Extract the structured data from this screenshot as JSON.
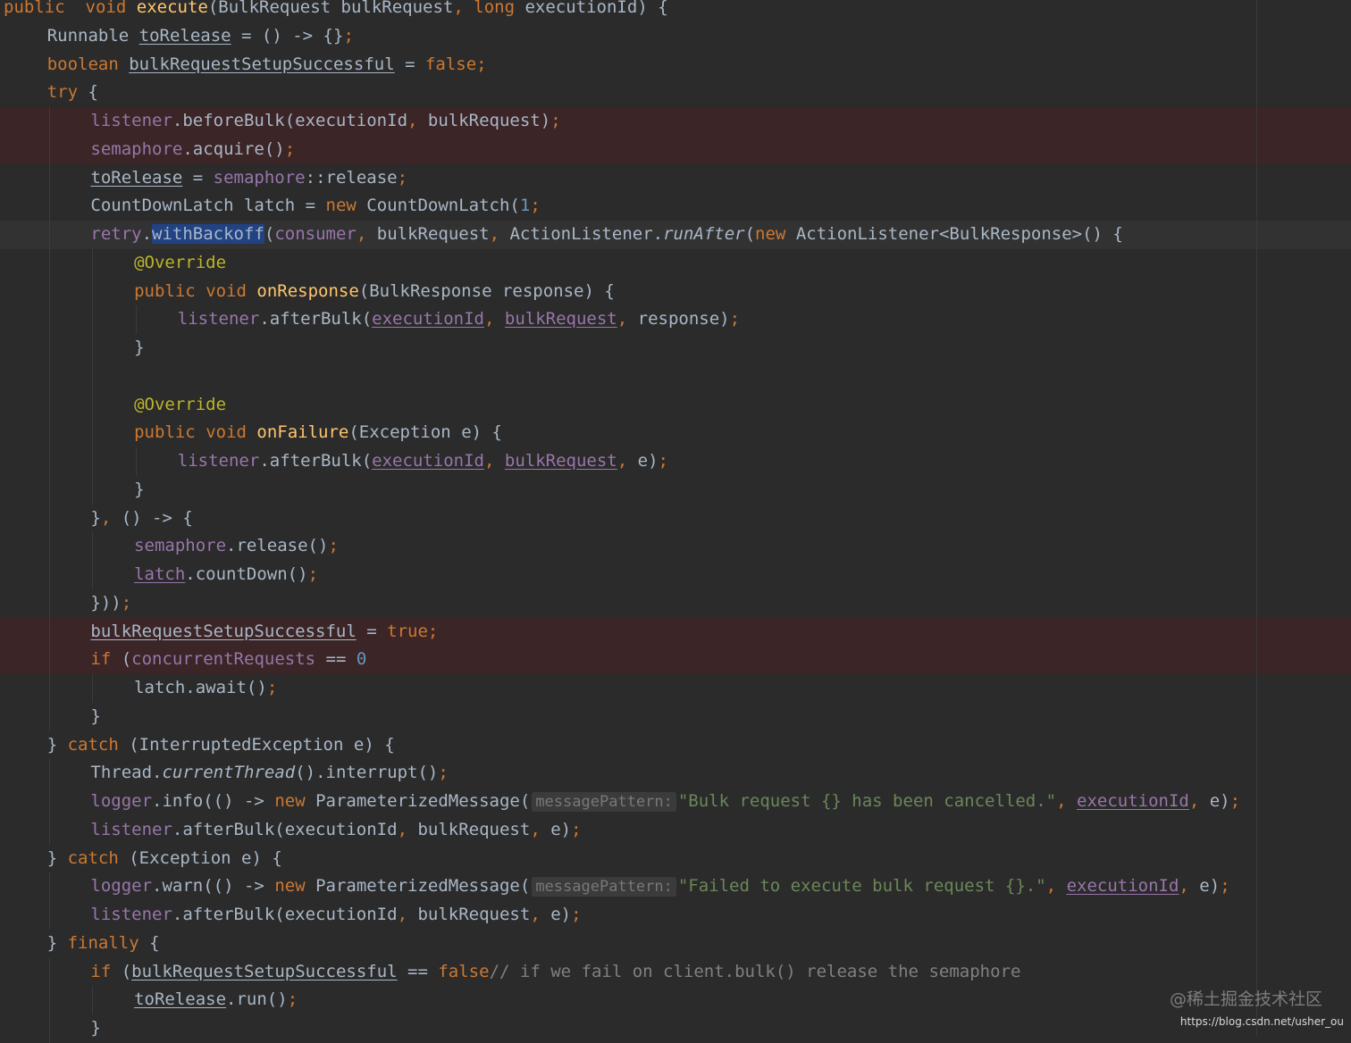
{
  "lines": [
    {
      "indent": 0,
      "tokens": [
        [
          "kw",
          "public"
        ],
        [
          "",
          "  "
        ],
        [
          "kw",
          "void"
        ],
        [
          "",
          " "
        ],
        [
          "fn",
          "execute"
        ],
        [
          "",
          "(BulkRequest bulkRequest"
        ],
        [
          "kw",
          ","
        ],
        [
          "",
          " "
        ],
        [
          "kw",
          "long"
        ],
        [
          "",
          " executionId) {"
        ]
      ]
    },
    {
      "indent": 1,
      "tokens": [
        [
          "",
          "Runnable "
        ],
        [
          "ul",
          "toRelease"
        ],
        [
          "",
          " = () -> {}"
        ],
        [
          "kw",
          ";"
        ]
      ]
    },
    {
      "indent": 1,
      "tokens": [
        [
          "kw",
          "boolean"
        ],
        [
          "",
          " "
        ],
        [
          "ul",
          "bulkRequestSetupSuccessful"
        ],
        [
          "",
          " = "
        ],
        [
          "kw",
          "false;"
        ]
      ]
    },
    {
      "indent": 1,
      "tokens": [
        [
          "kw",
          "try"
        ],
        [
          "",
          " {"
        ]
      ]
    },
    {
      "indent": 2,
      "bg": "err",
      "tokens": [
        [
          "field",
          "listener"
        ],
        [
          "",
          ".beforeBulk(executionId"
        ],
        [
          "kw",
          ","
        ],
        [
          "",
          " bulkRequest)"
        ],
        [
          "kw",
          ";"
        ]
      ]
    },
    {
      "indent": 2,
      "bg": "err",
      "tokens": [
        [
          "field",
          "semaphore"
        ],
        [
          "",
          ".acquire()"
        ],
        [
          "kw",
          ";"
        ]
      ]
    },
    {
      "indent": 2,
      "tokens": [
        [
          "ul",
          "toRelease"
        ],
        [
          "",
          " = "
        ],
        [
          "field",
          "semaphore"
        ],
        [
          "",
          "::release"
        ],
        [
          "kw",
          ";"
        ]
      ]
    },
    {
      "indent": 2,
      "tokens": [
        [
          "",
          "CountDownLatch latch = "
        ],
        [
          "kw",
          "new"
        ],
        [
          "",
          " CountDownLatch("
        ],
        [
          "num",
          "1"
        ],
        [
          ")"
        ],
        [
          "kw",
          ";"
        ]
      ]
    },
    {
      "indent": 2,
      "bg": "caret",
      "tokens": [
        [
          "field",
          "retry"
        ],
        [
          "",
          "."
        ],
        [
          "sel",
          "withBackoff"
        ],
        [
          "",
          "("
        ],
        [
          "field",
          "consumer"
        ],
        [
          "kw",
          ","
        ],
        [
          "",
          " bulkRequest"
        ],
        [
          "kw",
          ","
        ],
        [
          "",
          " ActionListener."
        ],
        [
          "it",
          "runAfter"
        ],
        [
          "",
          "("
        ],
        [
          "kw",
          "new"
        ],
        [
          "",
          " ActionListener<BulkResponse>() {"
        ]
      ]
    },
    {
      "indent": 3,
      "tokens": [
        [
          "ann",
          "@Override"
        ]
      ]
    },
    {
      "indent": 3,
      "tokens": [
        [
          "kw",
          "public"
        ],
        [
          "",
          " "
        ],
        [
          "kw",
          "void"
        ],
        [
          "",
          " "
        ],
        [
          "fn",
          "onResponse"
        ],
        [
          "",
          "(BulkResponse response) {"
        ]
      ]
    },
    {
      "indent": 4,
      "tokens": [
        [
          "field",
          "listener"
        ],
        [
          "",
          ".afterBulk("
        ],
        [
          "field ul",
          "executionId"
        ],
        [
          "kw",
          ","
        ],
        [
          "",
          " "
        ],
        [
          "field ul",
          "bulkRequest"
        ],
        [
          "kw",
          ","
        ],
        [
          "",
          " response)"
        ],
        [
          "kw",
          ";"
        ]
      ]
    },
    {
      "indent": 3,
      "tokens": [
        [
          "",
          "}"
        ]
      ]
    },
    {
      "indent": 3,
      "tokens": []
    },
    {
      "indent": 3,
      "tokens": [
        [
          "ann",
          "@Override"
        ]
      ]
    },
    {
      "indent": 3,
      "tokens": [
        [
          "kw",
          "public"
        ],
        [
          "",
          " "
        ],
        [
          "kw",
          "void"
        ],
        [
          "",
          " "
        ],
        [
          "fn",
          "onFailure"
        ],
        [
          "",
          "(Exception e) {"
        ]
      ]
    },
    {
      "indent": 4,
      "tokens": [
        [
          "field",
          "listener"
        ],
        [
          "",
          ".afterBulk("
        ],
        [
          "field ul",
          "executionId"
        ],
        [
          "kw",
          ","
        ],
        [
          "",
          " "
        ],
        [
          "field ul",
          "bulkRequest"
        ],
        [
          "kw",
          ","
        ],
        [
          "",
          " e)"
        ],
        [
          "kw",
          ";"
        ]
      ]
    },
    {
      "indent": 3,
      "tokens": [
        [
          "",
          "}"
        ]
      ]
    },
    {
      "indent": 2,
      "tokens": [
        [
          "",
          "}"
        ],
        [
          "kw",
          ","
        ],
        [
          "",
          " () -> {"
        ]
      ]
    },
    {
      "indent": 3,
      "tokens": [
        [
          "field",
          "semaphore"
        ],
        [
          "",
          ".release()"
        ],
        [
          "kw",
          ";"
        ]
      ]
    },
    {
      "indent": 3,
      "tokens": [
        [
          "field ul",
          "latch"
        ],
        [
          "",
          ".countDown()"
        ],
        [
          "kw",
          ";"
        ]
      ]
    },
    {
      "indent": 2,
      "tokens": [
        [
          "",
          "}))"
        ],
        [
          "kw",
          ";"
        ]
      ]
    },
    {
      "indent": 2,
      "bg": "err",
      "tokens": [
        [
          "ul",
          "bulkRequestSetupSuccessful"
        ],
        [
          "",
          " = "
        ],
        [
          "kw",
          "true;"
        ]
      ]
    },
    {
      "indent": 2,
      "bg": "err",
      "tokens": [
        [
          "kw",
          "if"
        ],
        [
          "",
          " ("
        ],
        [
          "field",
          "concurrentRequests"
        ],
        [
          "",
          " == "
        ],
        [
          "num",
          "0"
        ],
        [
          ") {"
        ]
      ]
    },
    {
      "indent": 3,
      "tokens": [
        [
          "",
          "latch.await()"
        ],
        [
          "kw",
          ";"
        ]
      ]
    },
    {
      "indent": 2,
      "tokens": [
        [
          "",
          "}"
        ]
      ]
    },
    {
      "indent": 1,
      "tokens": [
        [
          "",
          "} "
        ],
        [
          "kw",
          "catch"
        ],
        [
          "",
          " (InterruptedException e) {"
        ]
      ]
    },
    {
      "indent": 2,
      "tokens": [
        [
          "",
          "Thread."
        ],
        [
          "it",
          "currentThread"
        ],
        [
          "",
          "().interrupt()"
        ],
        [
          "kw",
          ";"
        ]
      ]
    },
    {
      "indent": 2,
      "tokens": [
        [
          "field",
          "logger"
        ],
        [
          "",
          ".info(() -> "
        ],
        [
          "kw",
          "new"
        ],
        [
          "",
          " ParameterizedMessage("
        ],
        [
          "hint",
          "messagePattern:"
        ],
        [
          "str",
          "\"Bulk request {} has been cancelled.\""
        ],
        [
          "kw",
          ","
        ],
        [
          "",
          " "
        ],
        [
          "field ul",
          "executionId"
        ],
        [
          ")"
        ],
        [
          "kw",
          ","
        ],
        [
          "",
          " e)"
        ],
        [
          "kw",
          ";"
        ]
      ]
    },
    {
      "indent": 2,
      "tokens": [
        [
          "field",
          "listener"
        ],
        [
          "",
          ".afterBulk(executionId"
        ],
        [
          "kw",
          ","
        ],
        [
          "",
          " bulkRequest"
        ],
        [
          "kw",
          ","
        ],
        [
          "",
          " e)"
        ],
        [
          "kw",
          ";"
        ]
      ]
    },
    {
      "indent": 1,
      "tokens": [
        [
          "",
          "} "
        ],
        [
          "kw",
          "catch"
        ],
        [
          "",
          " (Exception e) {"
        ]
      ]
    },
    {
      "indent": 2,
      "tokens": [
        [
          "field",
          "logger"
        ],
        [
          "",
          ".warn(() -> "
        ],
        [
          "kw",
          "new"
        ],
        [
          "",
          " ParameterizedMessage("
        ],
        [
          "hint",
          "messagePattern:"
        ],
        [
          "str",
          "\"Failed to execute bulk request {}.\""
        ],
        [
          "kw",
          ","
        ],
        [
          "",
          " "
        ],
        [
          "field ul",
          "executionId"
        ],
        [
          ")"
        ],
        [
          "kw",
          ","
        ],
        [
          "",
          " e)"
        ],
        [
          "kw",
          ";"
        ]
      ]
    },
    {
      "indent": 2,
      "tokens": [
        [
          "field",
          "listener"
        ],
        [
          "",
          ".afterBulk(executionId"
        ],
        [
          "kw",
          ","
        ],
        [
          "",
          " bulkRequest"
        ],
        [
          "kw",
          ","
        ],
        [
          "",
          " e)"
        ],
        [
          "kw",
          ";"
        ]
      ]
    },
    {
      "indent": 1,
      "tokens": [
        [
          "",
          "} "
        ],
        [
          "kw",
          "finally"
        ],
        [
          "",
          " {"
        ]
      ]
    },
    {
      "indent": 2,
      "tokens": [
        [
          "kw",
          "if"
        ],
        [
          "",
          " ("
        ],
        [
          "ul",
          "bulkRequestSetupSuccessful"
        ],
        [
          "",
          " == "
        ],
        [
          "kw",
          "false"
        ],
        [
          ") {  "
        ],
        [
          "cmt",
          "// if we fail on client.bulk() release the semaphore"
        ]
      ]
    },
    {
      "indent": 3,
      "tokens": [
        [
          "ul",
          "toRelease"
        ],
        [
          "",
          ".run()"
        ],
        [
          "kw",
          ";"
        ]
      ]
    },
    {
      "indent": 2,
      "tokens": [
        [
          "",
          "}"
        ]
      ]
    }
  ],
  "watermark": "@稀土掘金技术社区",
  "url": "https://blog.csdn.net/usher_ou"
}
